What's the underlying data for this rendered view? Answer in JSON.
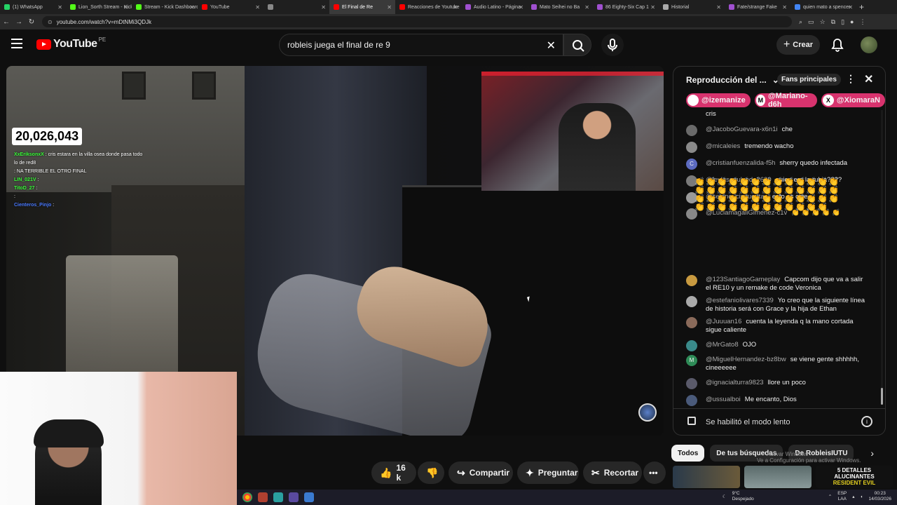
{
  "browser": {
    "tabs": [
      {
        "label": "(1) WhatsApp",
        "color": "#25d366",
        "active": false
      },
      {
        "label": "Lion_Sorth Stream - Kick",
        "color": "#53fc18",
        "active": false
      },
      {
        "label": "Stream - Kick Dashboard",
        "color": "#53fc18",
        "active": false
      },
      {
        "label": "YouTube",
        "color": "#ff0000",
        "active": false
      },
      {
        "label": "",
        "color": "#888888",
        "active": false
      },
      {
        "label": "El Final de Re",
        "color": "#ff0000",
        "active": true
      },
      {
        "label": "Reacciones de Youtube",
        "color": "#ff0000",
        "active": false
      },
      {
        "label": "Audio Latino - Página",
        "color": "#a050d0",
        "active": false
      },
      {
        "label": "Mato Seihei no Ba",
        "color": "#a050d0",
        "active": false
      },
      {
        "label": "86 Eighty-Six Cap 1",
        "color": "#a050d0",
        "active": false
      },
      {
        "label": "Historial",
        "color": "#aaaaaa",
        "active": false
      },
      {
        "label": "Fate/strange Fake",
        "color": "#a050d0",
        "active": false
      },
      {
        "label": "quien mato a spencer",
        "color": "#4285f4",
        "active": false
      }
    ],
    "url": "youtube.com/watch?v=mDtNMi3QDJk"
  },
  "header": {
    "logo_text": "YouTube",
    "country_code": "PE",
    "search_value": "robleis juega el final de re 9",
    "create_label": "Crear"
  },
  "video": {
    "viewer_count": "20,026,043",
    "overlay_chat": [
      {
        "user": "XxEriksonxX",
        "text": ": cris estara en la villa osea donde pasa todo lo de red8",
        "color": "#3aff3a"
      },
      {
        "user": "",
        "text": ": NA TERRIBLE EL OTRO FINAL",
        "color": "#ff3a3a"
      },
      {
        "user": "LIN_021V",
        "text": ":",
        "color": "#3aff3a"
      },
      {
        "user": "TitoD_27",
        "text": ":",
        "color": "#3aff3a"
      },
      {
        "user": "",
        "text": ":",
        "color": "#ff3a3a"
      },
      {
        "user": "Cienteros_Pinjo",
        "text": ":",
        "color": "#4a7aff"
      }
    ]
  },
  "actions": {
    "likes": "16 k",
    "share": "Compartir",
    "ask": "Preguntar",
    "clip": "Recortar"
  },
  "chat": {
    "title": "Reproducción del ...",
    "fans_label": "Fans principales",
    "pinned": [
      {
        "user": "@izemanize",
        "initial": "",
        "color": "#d8336e"
      },
      {
        "user": "@Mariano-d6h",
        "initial": "M",
        "color": "#d8336e"
      },
      {
        "user": "@XiomaraN",
        "initial": "X",
        "color": "#d8336e"
      }
    ],
    "top_fragment": "cris",
    "messages": [
      {
        "author": "@JacoboGuevara-x6n1i",
        "text": "che",
        "avatar_color": "#6a6a6a"
      },
      {
        "author": "@micaleies",
        "text": "tremendo wacho",
        "avatar_color": "#8a8a8a"
      },
      {
        "author": "@cristianfuenzalida-f5h",
        "text": "sherry quedo infectada",
        "avatar_color": "#5c6bc0",
        "initial": "C"
      },
      {
        "author": "@leylasepulveda2620",
        "text": "quien era la rubia????",
        "avatar_color": "#7a7a7a"
      },
      {
        "author": "@selene_cincuenta_",
        "text": "esto es cine",
        "avatar_color": "#9a9a9a"
      },
      {
        "author": "@LuciamagaliGimenez-c1v",
        "text": "👏 👏 👏 👏 👏",
        "avatar_color": "#888888"
      },
      {
        "author": "@123SantiagoGameplay",
        "text": "Capcom dijo que va a salir el RE10 y un remake de code Veronica",
        "avatar_color": "#c89a40"
      },
      {
        "author": "@estefaniolivares7339",
        "text": "Yo creo que la siguiente línea de historia será con Grace y la hija de Ethan",
        "avatar_color": "#aaaaaa"
      },
      {
        "author": "@Juuuan16",
        "text": "cuenta la leyenda q la mano cortada sigue caliente",
        "avatar_color": "#8a6a5a"
      },
      {
        "author": "@MrGato8",
        "text": "OJO",
        "avatar_color": "#3a8a8a"
      },
      {
        "author": "@MiguelHernandez-bz8bw",
        "text": "se viene gente shhhhh, cineeeeee",
        "avatar_color": "#2e8b57",
        "initial": "M"
      },
      {
        "author": "@ignacialturra9823",
        "text": "llore un poco",
        "avatar_color": "#5a5a6a"
      },
      {
        "author": "@ussualboi",
        "text": "Me encanto, Dios",
        "avatar_color": "#4a5a7a"
      }
    ],
    "clap_block": "👏👏👏👏👏👏👏👏👏👏👏👏👏👏👏👏👏👏👏👏👏👏👏👏👏👏👏👏👏👏👏👏👏👏👏👏👏👏👏👏👏👏👏👏👏👏👏👏👏👏👏",
    "slow_mode": "Se habilitó el modo lento"
  },
  "chips": [
    "Todos",
    "De tus búsquedas",
    "De RobleisIUTU"
  ],
  "windows_watermark": [
    "Activar Windows",
    "Ve a Configuración para activar Windows."
  ],
  "thumb_text": [
    "5 DETALLES",
    "ALUCINANTES",
    "RESIDENT EVIL"
  ],
  "taskbar": {
    "weather": "9°C",
    "weather_desc": "Despejado",
    "lang": "ESP",
    "lang2": "LAA",
    "time": "00:23",
    "date": "14/03/2026"
  }
}
